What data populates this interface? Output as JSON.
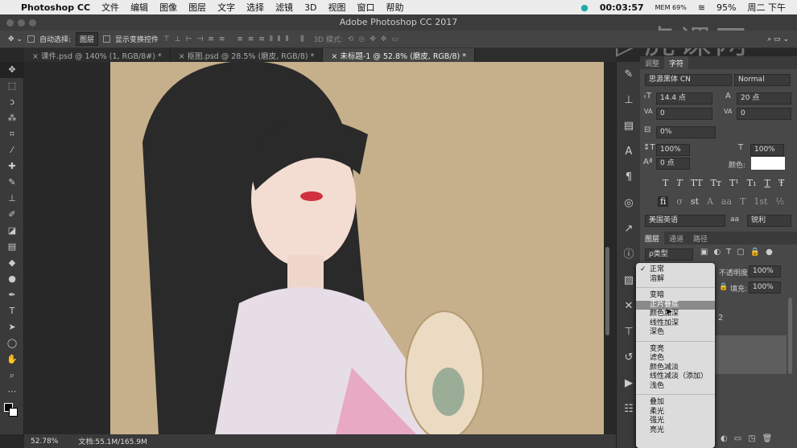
{
  "menubar": {
    "app": "Photoshop CC",
    "items": [
      "文件",
      "编辑",
      "图像",
      "图层",
      "文字",
      "选择",
      "滤镜",
      "3D",
      "视图",
      "窗口",
      "帮助"
    ],
    "timer": "00:03:57",
    "mem": "MEM 69%",
    "battery": "95%",
    "clock": "周二 下午"
  },
  "window": {
    "title": "Adobe Photoshop CC 2017"
  },
  "options": {
    "auto_select": "自动选择:",
    "auto_select_value": "图层",
    "show_transform": "显示变换控件",
    "mode_3d": "3D 模式:"
  },
  "tabs": [
    {
      "label": "课件.psd @ 140% (1, RGB/8#) *"
    },
    {
      "label": "抠图.psd @ 28.5% (磨皮, RGB/8) *"
    },
    {
      "label": "未标题-1 @ 52.8% (磨皮, RGB/8) *"
    }
  ],
  "status": {
    "zoom": "52.78%",
    "doc": "文档:55.1M/165.9M"
  },
  "character": {
    "tabs": [
      "调整",
      "字符"
    ],
    "font": "思源黑体 CN",
    "style": "Normal",
    "size": "14.4 点",
    "leading": "20 点",
    "kerning": "0",
    "tracking": "0",
    "scale_pct": "0%",
    "vscale": "100%",
    "hscale": "100%",
    "baseline": "0 点",
    "color_label": "颜色:",
    "glyph_row1": [
      "T",
      "T",
      "TT",
      "Tт",
      "T¹",
      "T₁",
      "T",
      "Ŧ"
    ],
    "glyph_row2": [
      "fi",
      "σ",
      "st",
      "A",
      "aa",
      "T",
      "1st",
      "½"
    ],
    "language": "美国英语",
    "aa_label": "aa",
    "antialias": "锐利"
  },
  "layers": {
    "tabs": [
      "图层",
      "通道",
      "路径"
    ],
    "filter": "ρ类型",
    "opacity_label": "不透明度:",
    "opacity": "100%",
    "fill_label": "填充:",
    "fill": "100%",
    "layer_fragment": "2"
  },
  "blend_menu": {
    "groups": [
      [
        "正常",
        "溶解"
      ],
      [
        "变暗",
        "正片叠底",
        "颜色加深",
        "线性加深",
        "深色"
      ],
      [
        "变亮",
        "滤色",
        "颜色减淡",
        "线性减淡（添加）",
        "浅色"
      ],
      [
        "叠加",
        "柔光",
        "强光",
        "亮光"
      ]
    ],
    "checked": "正常",
    "highlighted": "正片叠底"
  },
  "watermark": "虎课网"
}
